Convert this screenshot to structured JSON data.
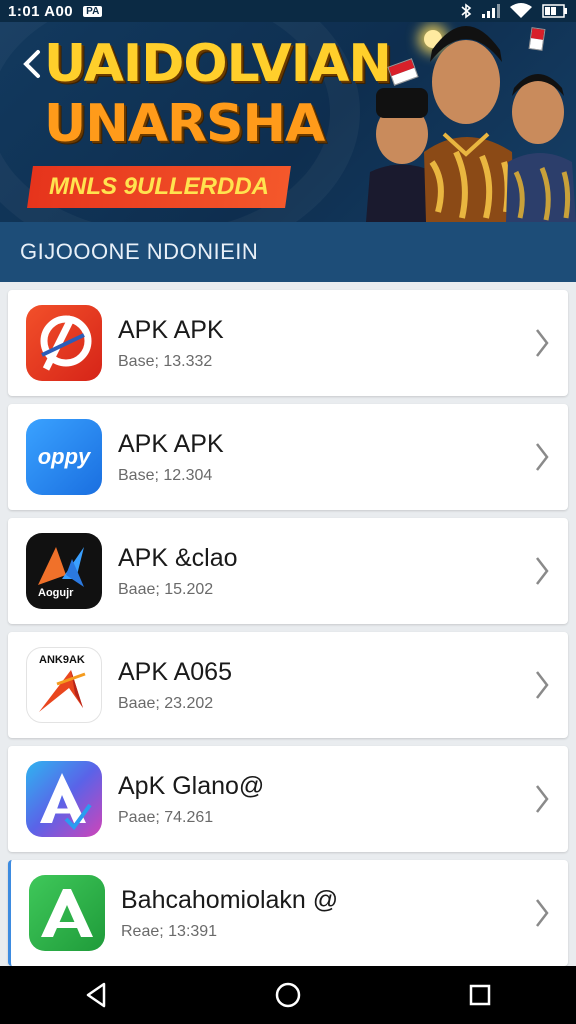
{
  "status_bar": {
    "time": "1:01 A00",
    "badge": "PA",
    "icons": [
      "sun-icon",
      "bluetooth-icon",
      "signal-icon",
      "wifi-icon",
      "battery-icon"
    ]
  },
  "banner": {
    "title_line1": "UAIDOLVIAN",
    "title_line2": "UNARSHA",
    "subtitle": "MNLS 9ULLERDDA",
    "back_icon": "chevron-left-icon"
  },
  "section": {
    "title": "GIJOOONE NDONIEIN"
  },
  "apps": [
    {
      "title": "APK APK",
      "subtitle": "Base; 13.332",
      "icon": "red-p-logo"
    },
    {
      "title": "APK APK",
      "subtitle": "Base; 12.304",
      "icon": "oppy-logo",
      "icon_text": "oppy"
    },
    {
      "title": "APK &clao",
      "subtitle": "Baae; 15.202",
      "icon": "black-ak-logo",
      "icon_text": "Aogujr"
    },
    {
      "title": "APK A065",
      "subtitle": "Baae; 23.202",
      "icon": "orange-arrow-logo",
      "icon_text": "ANK9AK"
    },
    {
      "title": "ApK Glano@",
      "subtitle": "Paae; 74.261",
      "icon": "gradient-a-logo"
    },
    {
      "title": "Bahcahomiolakn @",
      "subtitle": "Reae; 13:391",
      "icon": "green-a-logo"
    }
  ],
  "colors": {
    "banner_bg": "#12395e",
    "section_bg": "#1d4d78",
    "title_yellow": "#ffcf2b",
    "title_orange": "#ff9b1a",
    "ribbon_red": "#e6341c",
    "highlight_blue": "#3d8be0"
  },
  "nav": {
    "icons": [
      "back-triangle-icon",
      "home-circle-icon",
      "recents-square-icon"
    ]
  }
}
